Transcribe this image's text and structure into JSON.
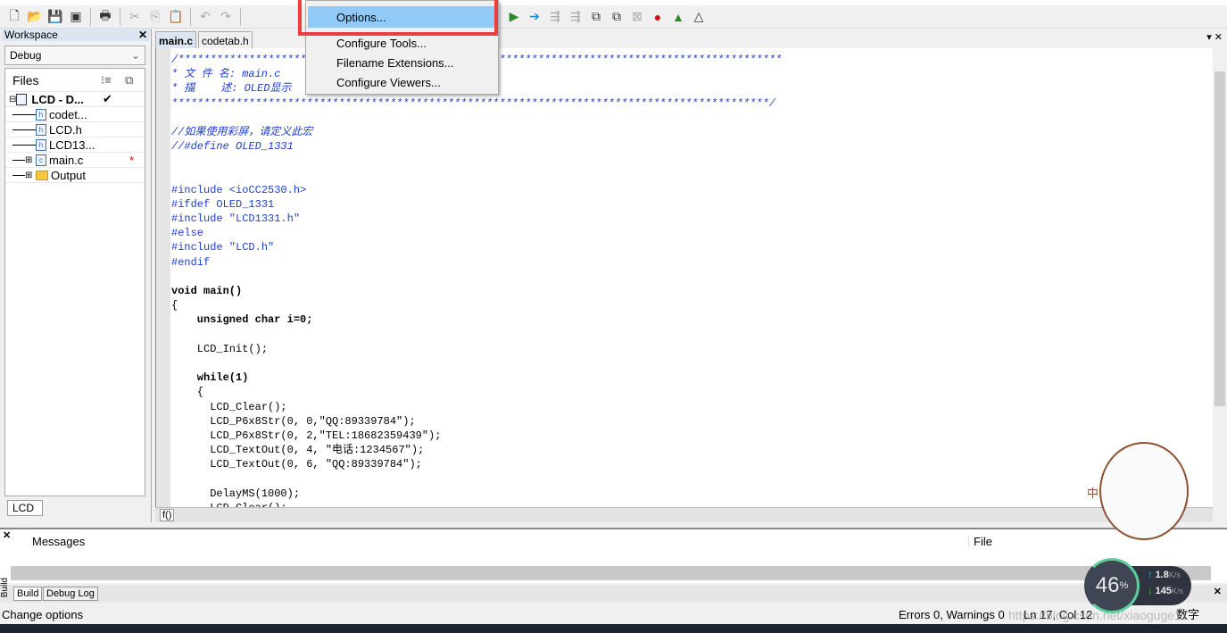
{
  "toolbar": {
    "icons": [
      "new-file-icon",
      "open-icon",
      "save-icon",
      "save-all-icon",
      "print-icon",
      "cut-icon",
      "copy-icon",
      "paste-icon",
      "undo-icon",
      "redo-icon"
    ]
  },
  "menu": {
    "items": [
      "Options...",
      "Configure Tools...",
      "Filename Extensions...",
      "Configure Viewers..."
    ],
    "highlight_color": "#91c9f7",
    "annotation_color": "#f03c3c"
  },
  "workspace": {
    "title": "Workspace",
    "config": "Debug",
    "files_header": "Files",
    "tree": [
      {
        "name": "LCD - D...",
        "check": "✔",
        "bold": true
      },
      {
        "name": "codet..."
      },
      {
        "name": "LCD.h"
      },
      {
        "name": "LCD13..."
      },
      {
        "name": "main.c",
        "mark": "*"
      },
      {
        "name": "Output"
      }
    ],
    "tab": "LCD"
  },
  "editor": {
    "tabs": [
      "main.c",
      "codetab.h"
    ],
    "lines": [
      {
        "t": "/**********************************************************************************************",
        "k": "comment"
      },
      {
        "t": "* 文 件 名: main.c",
        "k": "comment"
      },
      {
        "t": "* 描    述: OLED显示",
        "k": "comment"
      },
      {
        "t": "*********************************************************************************************/",
        "k": "comment"
      },
      {
        "t": "",
        "k": "code"
      },
      {
        "t": "//如果使用彩屏，请定义此宏",
        "k": "comment"
      },
      {
        "t": "//#define OLED_1331",
        "k": "comment"
      },
      {
        "t": "",
        "k": "code"
      },
      {
        "t": "",
        "k": "code"
      },
      {
        "t": "#include <ioCC2530.h>",
        "k": "pre"
      },
      {
        "t": "#ifdef OLED_1331",
        "k": "pre"
      },
      {
        "t": "#include \"LCD1331.h\"",
        "k": "pre"
      },
      {
        "t": "#else",
        "k": "pre"
      },
      {
        "t": "#include \"LCD.h\"",
        "k": "pre"
      },
      {
        "t": "#endif",
        "k": "pre"
      },
      {
        "t": "",
        "k": "code"
      },
      {
        "t": "void main()",
        "k": "code"
      },
      {
        "t": "{",
        "k": "code"
      },
      {
        "t": "    unsigned char i=0;",
        "k": "code"
      },
      {
        "t": "",
        "k": "code"
      },
      {
        "t": "    LCD_Init();",
        "k": "code"
      },
      {
        "t": "",
        "k": "code"
      },
      {
        "t": "    while(1)",
        "k": "code"
      },
      {
        "t": "    {",
        "k": "code"
      },
      {
        "t": "      LCD_Clear();",
        "k": "code"
      },
      {
        "t": "      LCD_P6x8Str(0, 0,\"QQ:89339784\");",
        "k": "code"
      },
      {
        "t": "      LCD_P6x8Str(0, 2,\"TEL:18682359439\");",
        "k": "code"
      },
      {
        "t": "      LCD_TextOut(0, 4, \"电话:1234567\");",
        "k": "code"
      },
      {
        "t": "      LCD_TextOut(0, 6, \"QQ:89339784\");",
        "k": "code"
      },
      {
        "t": "",
        "k": "code"
      },
      {
        "t": "      DelayMS(1000);",
        "k": "code"
      },
      {
        "t": "      LCD_Clear();",
        "k": "code"
      }
    ],
    "func_box": "f()"
  },
  "messages": {
    "col_messages": "Messages",
    "col_file": "File",
    "tabs": [
      "Build",
      "Debug Log"
    ],
    "side_label": "Build"
  },
  "status": {
    "left": "Change options",
    "errors": "Errors 0, Warnings 0",
    "position": "Ln 17, Col 12",
    "ime": "数字"
  },
  "overlay": {
    "cpu": "46",
    "cpu_unit": "%",
    "up": "1.8",
    "down": "145",
    "rate_unit": "K/s",
    "watermark": "https://blog.csdn.net/xiaoguge11",
    "mascot_char": "中"
  }
}
